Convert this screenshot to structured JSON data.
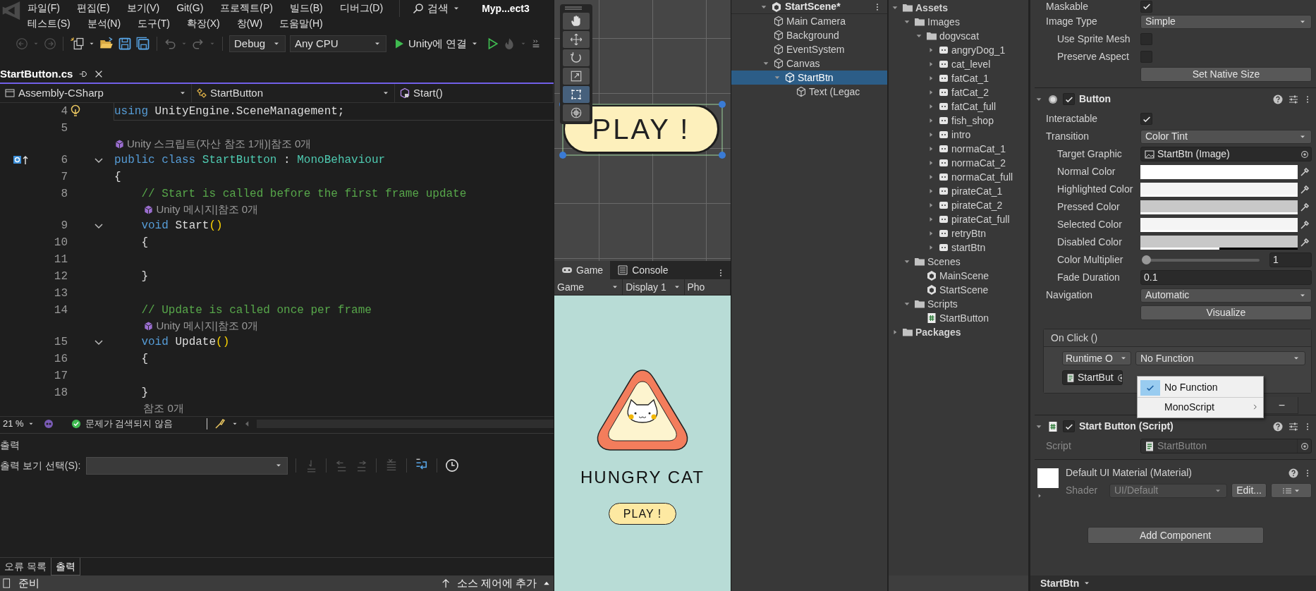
{
  "vs": {
    "menu_rows": [
      [
        "파일(F)",
        "편집(E)",
        "보기(V)",
        "Git(G)",
        "프로젝트(P)",
        "빌드(B)",
        "디버그(D)"
      ],
      [
        "테스트(S)",
        "분석(N)",
        "도구(T)",
        "확장(X)",
        "창(W)",
        "도움말(H)"
      ]
    ],
    "search": "검색",
    "project_title": "Myp...ect3",
    "toolbar": {
      "configuration": "Debug",
      "platform": "Any CPU",
      "run_label": "Unity에 연결"
    },
    "tabs": [
      {
        "label": "StartButton.cs",
        "selected": true
      }
    ],
    "nav": [
      "Assembly-CSharp",
      "StartButton",
      "Start()"
    ],
    "code_lines": [
      {
        "kind": "code",
        "number": "4",
        "lightbulb": true,
        "foldable": false,
        "tokens": [
          {
            "kind": "kw",
            "text": "using"
          },
          {
            "kind": "plain",
            "text": " UnityEngine.SceneManagement;"
          }
        ]
      },
      {
        "kind": "code",
        "number": "5",
        "foldable": false
      },
      {
        "kind": "lens",
        "unity_icon": true,
        "text": "Unity 스크립트(자산 참조 1개)|참조 0개"
      },
      {
        "kind": "code",
        "number": "6",
        "implements": true,
        "foldable": true,
        "tokens": [
          {
            "kind": "kw",
            "text": "public class "
          },
          {
            "kind": "type",
            "text": "StartButton"
          },
          {
            "kind": "plain",
            "text": " : "
          },
          {
            "kind": "type",
            "text": "MonoBehaviour"
          }
        ]
      },
      {
        "kind": "code",
        "number": "7",
        "foldable": false,
        "tokens": [
          {
            "kind": "plain",
            "text": "{"
          }
        ]
      },
      {
        "kind": "code",
        "number": "8",
        "foldable": false,
        "tokens": [
          {
            "kind": "comment",
            "text": "    // Start is called before the first frame update"
          }
        ]
      },
      {
        "kind": "lens",
        "unity_icon": true,
        "text": "    Unity 메시지|참조 0개"
      },
      {
        "kind": "code",
        "number": "9",
        "foldable": true,
        "tokens": [
          {
            "kind": "kw",
            "text": "    void "
          },
          {
            "kind": "plain",
            "text": "Start"
          },
          {
            "kind": "paren",
            "text": "()"
          }
        ]
      },
      {
        "kind": "code",
        "number": "10",
        "foldable": false,
        "tokens": [
          {
            "kind": "plain",
            "text": "    {"
          }
        ]
      },
      {
        "kind": "code",
        "number": "11",
        "foldable": false
      },
      {
        "kind": "code",
        "number": "12",
        "foldable": false,
        "tokens": [
          {
            "kind": "plain",
            "text": "    }"
          }
        ]
      },
      {
        "kind": "code",
        "number": "13",
        "foldable": false
      },
      {
        "kind": "code",
        "number": "14",
        "foldable": false,
        "tokens": [
          {
            "kind": "comment",
            "text": "    // Update is called once per frame"
          }
        ]
      },
      {
        "kind": "lens",
        "unity_icon": true,
        "text": "    Unity 메시지|참조 0개"
      },
      {
        "kind": "code",
        "number": "15",
        "foldable": true,
        "tokens": [
          {
            "kind": "kw",
            "text": "    void "
          },
          {
            "kind": "plain",
            "text": "Update"
          },
          {
            "kind": "paren",
            "text": "()"
          }
        ]
      },
      {
        "kind": "code",
        "number": "16",
        "foldable": false,
        "tokens": [
          {
            "kind": "plain",
            "text": "    {"
          }
        ]
      },
      {
        "kind": "code",
        "number": "17",
        "foldable": false
      },
      {
        "kind": "code",
        "number": "18",
        "foldable": false,
        "tokens": [
          {
            "kind": "plain",
            "text": "    }"
          }
        ]
      },
      {
        "kind": "lens",
        "unity_icon": false,
        "text": "    참조 0개"
      }
    ],
    "editor_status": {
      "zoom": "21 %",
      "issues": "문제가 검색되지 않음"
    },
    "output": {
      "title": "출력",
      "select_label": "출력 보기 선택(S):"
    },
    "bottom_tabs": [
      {
        "label": "오류 목록",
        "selected": false
      },
      {
        "label": "출력",
        "selected": true
      }
    ],
    "status": {
      "left": "준비",
      "right": "소스 제어에 추가"
    }
  },
  "scene": {
    "tools": [
      {
        "selected": false
      },
      {
        "selected": false
      },
      {
        "selected": false
      },
      {
        "selected": false
      },
      {
        "selected": true
      },
      {
        "selected": false
      }
    ],
    "button_text": "PLAY !"
  },
  "game": {
    "tabs": [
      {
        "label": "Game",
        "selected": true
      },
      {
        "label": "Console",
        "selected": false
      }
    ],
    "toolbar": [
      "Game",
      "Display 1",
      "Pho"
    ],
    "title": "HUNGRY CAT",
    "button_text": "PLAY !"
  },
  "hierarchy": {
    "scene": "StartScene*",
    "items": [
      {
        "label": "Main Camera",
        "selected": false
      },
      {
        "label": "Background",
        "selected": false
      },
      {
        "label": "EventSystem",
        "selected": false
      },
      {
        "label": "Canvas",
        "selected": false,
        "expanded": true,
        "children": [
          {
            "label": "StartBtn",
            "selected": true,
            "expanded": true,
            "children": [
              {
                "label": "Text (Legac",
                "selected": false
              }
            ]
          }
        ]
      }
    ]
  },
  "project": {
    "items": [
      {
        "label": "Assets",
        "kind": "folder",
        "expanded": true,
        "children": [
          {
            "label": "Images",
            "kind": "folder",
            "expanded": true,
            "children": [
              {
                "label": "dogvscat",
                "kind": "folder",
                "expanded": true,
                "children": [
                  {
                    "label": "angryDog_1",
                    "kind": "sprite",
                    "expanded": false
                  },
                  {
                    "label": "cat_level",
                    "kind": "sprite",
                    "expanded": false
                  },
                  {
                    "label": "fatCat_1",
                    "kind": "sprite",
                    "expanded": false
                  },
                  {
                    "label": "fatCat_2",
                    "kind": "sprite",
                    "expanded": false
                  },
                  {
                    "label": "fatCat_full",
                    "kind": "sprite",
                    "expanded": false
                  },
                  {
                    "label": "fish_shop",
                    "kind": "sprite",
                    "expanded": false
                  },
                  {
                    "label": "intro",
                    "kind": "sprite",
                    "expanded": false
                  },
                  {
                    "label": "normaCat_1",
                    "kind": "sprite",
                    "expanded": false
                  },
                  {
                    "label": "normaCat_2",
                    "kind": "sprite",
                    "expanded": false
                  },
                  {
                    "label": "normaCat_full",
                    "kind": "sprite",
                    "expanded": false
                  },
                  {
                    "label": "pirateCat_1",
                    "kind": "sprite",
                    "expanded": false
                  },
                  {
                    "label": "pirateCat_2",
                    "kind": "sprite",
                    "expanded": false
                  },
                  {
                    "label": "pirateCat_full",
                    "kind": "sprite",
                    "expanded": false
                  },
                  {
                    "label": "retryBtn",
                    "kind": "sprite",
                    "expanded": false
                  },
                  {
                    "label": "startBtn",
                    "kind": "sprite",
                    "expanded": false
                  }
                ]
              }
            ]
          },
          {
            "label": "Scenes",
            "kind": "folder",
            "expanded": true,
            "children": [
              {
                "label": "MainScene",
                "kind": "scene"
              },
              {
                "label": "StartScene",
                "kind": "scene"
              }
            ]
          },
          {
            "label": "Scripts",
            "kind": "folder",
            "expanded": true,
            "children": [
              {
                "label": "StartButton",
                "kind": "script"
              }
            ]
          }
        ]
      },
      {
        "label": "Packages",
        "kind": "folder",
        "expanded": false
      }
    ]
  },
  "inspector": {
    "rows": [
      {
        "kind": "checkbox",
        "label": "Maskable",
        "checked": true,
        "indented": false
      },
      {
        "kind": "dropdown",
        "label": "Image Type",
        "value": "Simple",
        "indented": false
      },
      {
        "kind": "checkbox",
        "label": "Use Sprite Mesh",
        "checked": false,
        "indented": true
      },
      {
        "kind": "checkbox",
        "label": "Preserve Aspect",
        "checked": false,
        "indented": true
      },
      {
        "kind": "button",
        "label": "Set Native Size"
      },
      {
        "kind": "component_header",
        "title": "Button",
        "enabled": true
      },
      {
        "kind": "checkbox",
        "label": "Interactable",
        "checked": true,
        "indented": false
      },
      {
        "kind": "dropdown",
        "label": "Transition",
        "value": "Color Tint",
        "indented": false
      },
      {
        "kind": "object",
        "label": "Target Graphic",
        "value": "StartBtn (Image)",
        "disabled": false,
        "indented": true
      },
      {
        "kind": "color",
        "label": "Normal Color",
        "color": "#ffffff",
        "level": 1,
        "indented": true
      },
      {
        "kind": "color",
        "label": "Highlighted Color",
        "color": "#f5f5f5",
        "level": 1,
        "indented": true
      },
      {
        "kind": "color",
        "label": "Pressed Color",
        "color": "#c8c8c8",
        "level": 1,
        "indented": true
      },
      {
        "kind": "color",
        "label": "Selected Color",
        "color": "#f5f5f5",
        "level": 1,
        "indented": true
      },
      {
        "kind": "color",
        "label": "Disabled Color",
        "color": "#c8c8c8",
        "level": 0.5,
        "indented": true
      },
      {
        "kind": "slider",
        "label": "Color Multiplier",
        "level": 0,
        "value": "1",
        "indented": true
      },
      {
        "kind": "number",
        "label": "Fade Duration",
        "value": "0.1",
        "indented": true
      },
      {
        "kind": "dropdown",
        "label": "Navigation",
        "value": "Automatic",
        "indented": false
      },
      {
        "kind": "button",
        "label": "Visualize"
      },
      {
        "kind": "event",
        "title": "On Click ()",
        "mode": "Runtime O",
        "function": "No Function",
        "object": "StartBut",
        "remove": "−",
        "menu": [
          {
            "label": "No Function",
            "selected": true,
            "submenu": false
          },
          {
            "label": "MonoScript",
            "selected": false,
            "submenu": true
          }
        ]
      },
      {
        "kind": "script_header",
        "title": "Start Button (Script)",
        "enabled": true
      },
      {
        "kind": "object",
        "label": "Script",
        "value": "StartButton",
        "disabled": true,
        "indented": false
      },
      {
        "kind": "material",
        "title": "Default UI Material (Material)",
        "shader_label": "Shader",
        "shader": "UI/Default",
        "edit": "Edit..."
      },
      {
        "kind": "add",
        "label": "Add Component"
      }
    ],
    "footer": "StartBtn"
  }
}
